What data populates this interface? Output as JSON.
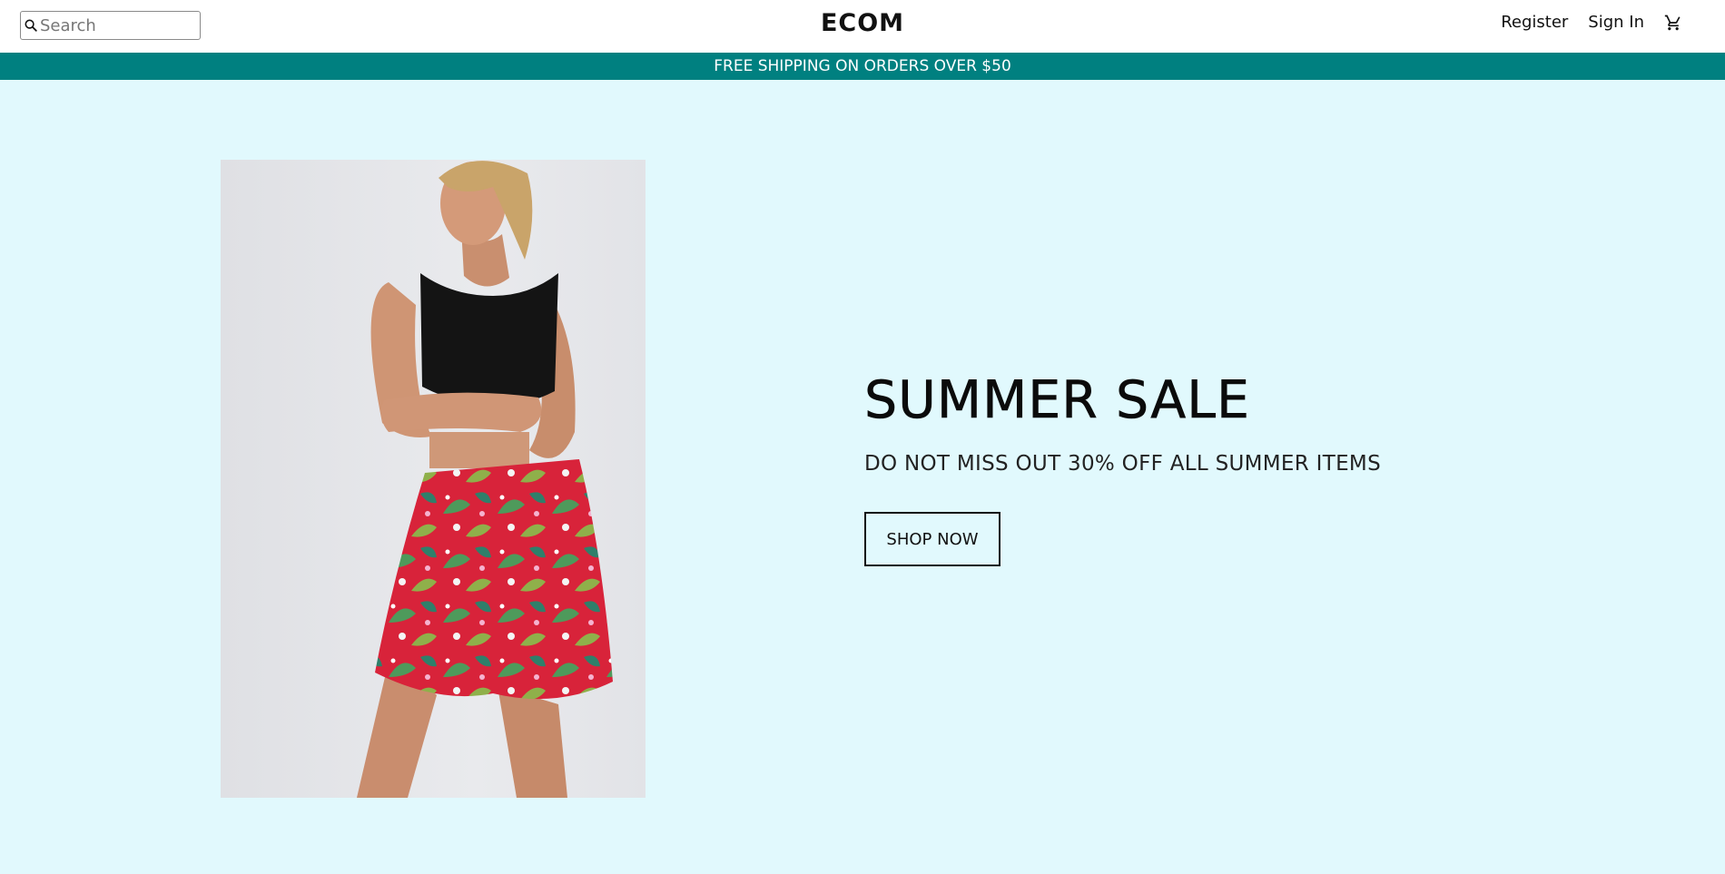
{
  "header": {
    "search": {
      "placeholder": "Search",
      "value": ""
    },
    "logo": "ECOM",
    "nav": {
      "register": "Register",
      "sign_in": "Sign In"
    }
  },
  "announcement": {
    "text": "FREE SHIPPING ON ORDERS OVER $50"
  },
  "hero": {
    "title": "SUMMER SALE",
    "subtitle": "DO NOT MISS OUT 30% OFF ALL SUMMER ITEMS",
    "button_label": "SHOP NOW",
    "background_color": "#e1f9fd"
  },
  "colors": {
    "announcement_bg": "#008080",
    "announcement_text": "#ffffff",
    "skirt_red": "#d8233a",
    "top_black": "#141414"
  },
  "icons": {
    "search": "search-icon",
    "cart": "cart-icon"
  }
}
